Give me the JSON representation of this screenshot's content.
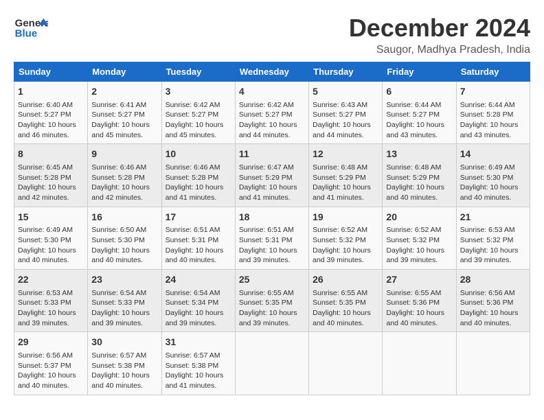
{
  "header": {
    "logo_line1": "General",
    "logo_line2": "Blue",
    "title": "December 2024",
    "subtitle": "Saugor, Madhya Pradesh, India"
  },
  "calendar": {
    "days_of_week": [
      "Sunday",
      "Monday",
      "Tuesday",
      "Wednesday",
      "Thursday",
      "Friday",
      "Saturday"
    ],
    "weeks": [
      [
        {
          "day": "",
          "info": ""
        },
        {
          "day": "2",
          "info": "Sunrise: 6:41 AM\nSunset: 5:27 PM\nDaylight: 10 hours\nand 45 minutes."
        },
        {
          "day": "3",
          "info": "Sunrise: 6:42 AM\nSunset: 5:27 PM\nDaylight: 10 hours\nand 45 minutes."
        },
        {
          "day": "4",
          "info": "Sunrise: 6:42 AM\nSunset: 5:27 PM\nDaylight: 10 hours\nand 44 minutes."
        },
        {
          "day": "5",
          "info": "Sunrise: 6:43 AM\nSunset: 5:27 PM\nDaylight: 10 hours\nand 44 minutes."
        },
        {
          "day": "6",
          "info": "Sunrise: 6:44 AM\nSunset: 5:27 PM\nDaylight: 10 hours\nand 43 minutes."
        },
        {
          "day": "7",
          "info": "Sunrise: 6:44 AM\nSunset: 5:28 PM\nDaylight: 10 hours\nand 43 minutes."
        }
      ],
      [
        {
          "day": "1",
          "info": "Sunrise: 6:40 AM\nSunset: 5:27 PM\nDaylight: 10 hours\nand 46 minutes."
        },
        {
          "day": "",
          "info": ""
        },
        {
          "day": "",
          "info": ""
        },
        {
          "day": "",
          "info": ""
        },
        {
          "day": "",
          "info": ""
        },
        {
          "day": "",
          "info": ""
        },
        {
          "day": "",
          "info": ""
        }
      ],
      [
        {
          "day": "8",
          "info": "Sunrise: 6:45 AM\nSunset: 5:28 PM\nDaylight: 10 hours\nand 42 minutes."
        },
        {
          "day": "9",
          "info": "Sunrise: 6:46 AM\nSunset: 5:28 PM\nDaylight: 10 hours\nand 42 minutes."
        },
        {
          "day": "10",
          "info": "Sunrise: 6:46 AM\nSunset: 5:28 PM\nDaylight: 10 hours\nand 41 minutes."
        },
        {
          "day": "11",
          "info": "Sunrise: 6:47 AM\nSunset: 5:29 PM\nDaylight: 10 hours\nand 41 minutes."
        },
        {
          "day": "12",
          "info": "Sunrise: 6:48 AM\nSunset: 5:29 PM\nDaylight: 10 hours\nand 41 minutes."
        },
        {
          "day": "13",
          "info": "Sunrise: 6:48 AM\nSunset: 5:29 PM\nDaylight: 10 hours\nand 40 minutes."
        },
        {
          "day": "14",
          "info": "Sunrise: 6:49 AM\nSunset: 5:30 PM\nDaylight: 10 hours\nand 40 minutes."
        }
      ],
      [
        {
          "day": "15",
          "info": "Sunrise: 6:49 AM\nSunset: 5:30 PM\nDaylight: 10 hours\nand 40 minutes."
        },
        {
          "day": "16",
          "info": "Sunrise: 6:50 AM\nSunset: 5:30 PM\nDaylight: 10 hours\nand 40 minutes."
        },
        {
          "day": "17",
          "info": "Sunrise: 6:51 AM\nSunset: 5:31 PM\nDaylight: 10 hours\nand 40 minutes."
        },
        {
          "day": "18",
          "info": "Sunrise: 6:51 AM\nSunset: 5:31 PM\nDaylight: 10 hours\nand 39 minutes."
        },
        {
          "day": "19",
          "info": "Sunrise: 6:52 AM\nSunset: 5:32 PM\nDaylight: 10 hours\nand 39 minutes."
        },
        {
          "day": "20",
          "info": "Sunrise: 6:52 AM\nSunset: 5:32 PM\nDaylight: 10 hours\nand 39 minutes."
        },
        {
          "day": "21",
          "info": "Sunrise: 6:53 AM\nSunset: 5:32 PM\nDaylight: 10 hours\nand 39 minutes."
        }
      ],
      [
        {
          "day": "22",
          "info": "Sunrise: 6:53 AM\nSunset: 5:33 PM\nDaylight: 10 hours\nand 39 minutes."
        },
        {
          "day": "23",
          "info": "Sunrise: 6:54 AM\nSunset: 5:33 PM\nDaylight: 10 hours\nand 39 minutes."
        },
        {
          "day": "24",
          "info": "Sunrise: 6:54 AM\nSunset: 5:34 PM\nDaylight: 10 hours\nand 39 minutes."
        },
        {
          "day": "25",
          "info": "Sunrise: 6:55 AM\nSunset: 5:35 PM\nDaylight: 10 hours\nand 39 minutes."
        },
        {
          "day": "26",
          "info": "Sunrise: 6:55 AM\nSunset: 5:35 PM\nDaylight: 10 hours\nand 40 minutes."
        },
        {
          "day": "27",
          "info": "Sunrise: 6:55 AM\nSunset: 5:36 PM\nDaylight: 10 hours\nand 40 minutes."
        },
        {
          "day": "28",
          "info": "Sunrise: 6:56 AM\nSunset: 5:36 PM\nDaylight: 10 hours\nand 40 minutes."
        }
      ],
      [
        {
          "day": "29",
          "info": "Sunrise: 6:56 AM\nSunset: 5:37 PM\nDaylight: 10 hours\nand 40 minutes."
        },
        {
          "day": "30",
          "info": "Sunrise: 6:57 AM\nSunset: 5:38 PM\nDaylight: 10 hours\nand 40 minutes."
        },
        {
          "day": "31",
          "info": "Sunrise: 6:57 AM\nSunset: 5:38 PM\nDaylight: 10 hours\nand 41 minutes."
        },
        {
          "day": "",
          "info": ""
        },
        {
          "day": "",
          "info": ""
        },
        {
          "day": "",
          "info": ""
        },
        {
          "day": "",
          "info": ""
        }
      ]
    ]
  }
}
